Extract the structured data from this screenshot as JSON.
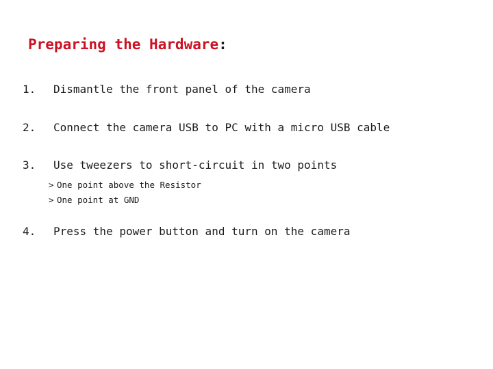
{
  "slide": {
    "title": {
      "text": "Preparing the Hardware",
      "trailing_punctuation": ":",
      "color": "#cc1122",
      "punctuation_color": "#1a1a1a"
    },
    "body_color": "#1a1a1a",
    "background_color": "#ffffff",
    "steps": [
      {
        "number": "1.",
        "text": "Dismantle the front panel of the camera"
      },
      {
        "number": "2.",
        "text": "Connect the camera USB to PC with a micro USB cable"
      },
      {
        "number": "3.",
        "text": "Use tweezers to short-circuit in two points"
      },
      {
        "number": "4.",
        "text": "Press the power button and turn on the camera"
      }
    ],
    "subitems": [
      {
        "marker": ">",
        "text": "One point above the Resistor"
      },
      {
        "marker": ">",
        "text": "One point at GND"
      }
    ]
  }
}
